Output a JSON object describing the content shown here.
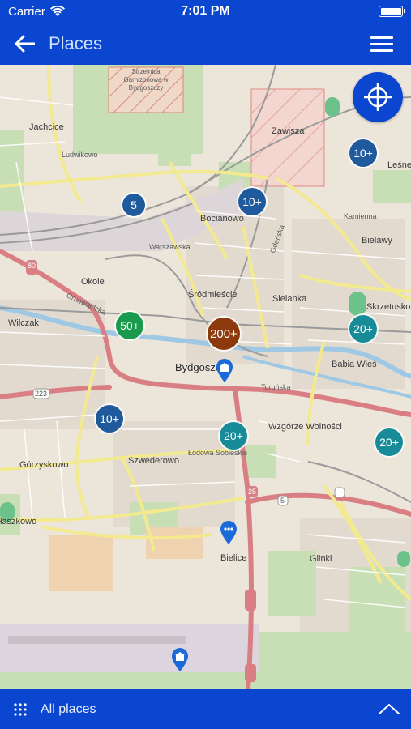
{
  "status_bar": {
    "carrier": "Carrier",
    "time": "7:01 PM",
    "icons": [
      "wifi-icon",
      "battery-icon"
    ]
  },
  "nav": {
    "title": "Places",
    "back_icon": "arrow-left-icon",
    "menu_icon": "hamburger-menu-icon"
  },
  "map": {
    "locate_icon": "crosshair-target-icon",
    "clusters": [
      {
        "label": "5",
        "color": "blue"
      },
      {
        "label": "10+",
        "color": "blue"
      },
      {
        "label": "10+",
        "color": "blue"
      },
      {
        "label": "50+",
        "color": "green"
      },
      {
        "label": "200+",
        "color": "brown"
      },
      {
        "label": "20+",
        "color": "teal"
      },
      {
        "label": "10+",
        "color": "blue"
      },
      {
        "label": "20+",
        "color": "teal"
      },
      {
        "label": "20+",
        "color": "teal"
      }
    ],
    "labels": {
      "jachcice": "Jachcice",
      "zawisza": "Zawisza",
      "lesne": "Leśne",
      "bocianowo": "Bocianowo",
      "bielawy": "Bielawy",
      "okole": "Okole",
      "srodmiescie": "Śródmieście",
      "sielanka": "Sielanka",
      "skrzetusko": "Skrzetusko",
      "wilczak": "Wilczak",
      "bydgoszcz": "Bydgoszcz",
      "babia_wies": "Babia Wieś",
      "wzgorze": "Wzgórze Wolności",
      "gorzyskowo": "Górzyskowo",
      "szwederowo": "Szwederowo",
      "glinki": "Glinki",
      "bielice": "Bielice",
      "laszkowo": "łaszkowo",
      "garrison": "Strzelnica Garnizonowa w Bydgoszczy",
      "lesna_ul": "Ludwikowo",
      "gdanska": "Gdańska",
      "kaminskiego": "Kamienna",
      "toruńska": "Toruńska",
      "lodowa": "Łodowa Sobieskie",
      "road_25": "25",
      "road_5": "5",
      "road_80": "80",
      "road_223": "223",
      "grunwaldzka": "Grunwaldzka",
      "warszawska": "Warszawska"
    },
    "pins": [
      {
        "name": "city-landmark-pin",
        "icon": "building-icon"
      },
      {
        "name": "info-pin",
        "icon": "dots-icon"
      },
      {
        "name": "airport-pin",
        "icon": "building-icon"
      }
    ]
  },
  "bottom_bar": {
    "label": "All places",
    "grid_icon": "grid-dots-icon",
    "chevron_icon": "chevron-up-icon"
  }
}
